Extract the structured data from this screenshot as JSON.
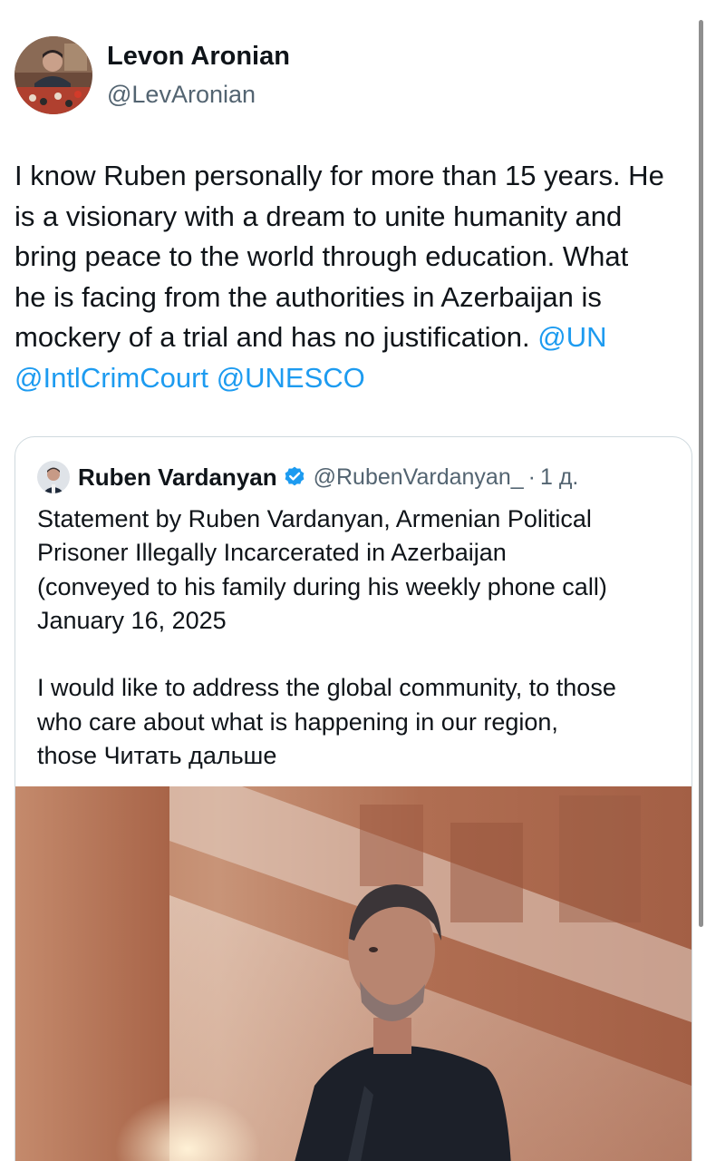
{
  "tweet": {
    "author": {
      "name": "Levon Aronian",
      "handle": "@LevAronian"
    },
    "text_lines": [
      "I know Ruben personally for more than 15 years. He",
      "is a visionary with a dream to unite humanity and",
      "bring peace to the world through education. What",
      "he is facing from the authorities in Azerbaijan is",
      "mockery of a trial and has no justification. "
    ],
    "mentions": [
      "@UN",
      "@IntlCrimCourt",
      "@UNESCO"
    ]
  },
  "quoted": {
    "author": {
      "name": "Ruben Vardanyan",
      "handle": "@RubenVardanyan_",
      "separator": "·",
      "time": "1 д."
    },
    "paragraph1_lines": [
      "Statement by Ruben Vardanyan, Armenian Political",
      "Prisoner Illegally Incarcerated in Azerbaijan",
      "(conveyed to his family during his weekly phone call)",
      "January 16, 2025"
    ],
    "paragraph2_lines": [
      "I would like to address the global community, to those",
      "who care about what is happening in our region,"
    ],
    "last_line_start": "those ",
    "read_more": "Читать дальше"
  },
  "icons": {
    "verified": "verified-badge-icon",
    "verified_color": "#1d9bf0"
  },
  "colors": {
    "mention": "#1d9bf0",
    "text": "#0f1419",
    "secondary": "#536471",
    "border": "#cfd9de"
  }
}
